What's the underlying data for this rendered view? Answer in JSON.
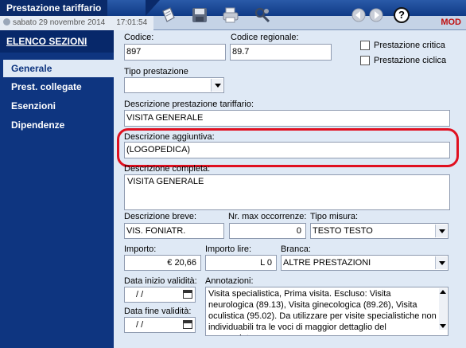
{
  "window": {
    "title": "Prestazione tariffario",
    "date": "sabato 29 novembre 2014",
    "time": "17:01:54",
    "mode_badge": "MOD"
  },
  "toolbar": {
    "icons": [
      "note-icon",
      "save-icon",
      "print-icon",
      "tools-icon",
      "back-arrow-icon",
      "forward-arrow-icon",
      "help-icon"
    ],
    "help_label": "?"
  },
  "sidebar": {
    "heading": "ELENCO SEZIONI",
    "items": [
      {
        "label": "Generale",
        "active": true
      },
      {
        "label": "Prest. collegate",
        "active": false
      },
      {
        "label": "Esenzioni",
        "active": false
      },
      {
        "label": "Dipendenze",
        "active": false
      }
    ]
  },
  "form": {
    "codice": {
      "label": "Codice:",
      "value": "897"
    },
    "codice_regionale": {
      "label": "Codice regionale:",
      "value": "89.7"
    },
    "prestazione_critica": {
      "label": "Prestazione critica",
      "checked": false
    },
    "prestazione_ciclica": {
      "label": "Prestazione ciclica",
      "checked": false
    },
    "tipo_prestazione": {
      "label": "Tipo prestazione",
      "value": ""
    },
    "descrizione_tariffario": {
      "label": "Descrizione prestazione tariffario:",
      "value": "VISITA GENERALE"
    },
    "descrizione_aggiuntiva": {
      "label": "Descrizione aggiuntiva:",
      "value": "(LOGOPEDICA)"
    },
    "descrizione_completa": {
      "label": "Descrizione completa:",
      "value": "VISITA GENERALE"
    },
    "descrizione_breve": {
      "label": "Descrizione breve:",
      "value": "VIS. FONIATR."
    },
    "nr_max_occorrenze": {
      "label": "Nr. max occorrenze:",
      "value": "0"
    },
    "tipo_misura": {
      "label": "Tipo misura:",
      "value": "TESTO TESTO"
    },
    "importo": {
      "label": "Importo:",
      "value": "€ 20,66"
    },
    "importo_lire": {
      "label": "Importo lire:",
      "value": "L 0"
    },
    "branca": {
      "label": "Branca:",
      "value": "ALTRE PRESTAZIONI"
    },
    "data_inizio": {
      "label": "Data inizio validità:",
      "value": "/ /"
    },
    "data_fine": {
      "label": "Data fine validità:",
      "value": "/ /"
    },
    "annotazioni": {
      "label": "Annotazioni:",
      "value": "Visita specialistica, Prima visita. Escluso: Visita neurologica (89.13), Visita ginecologica (89.26), Visita oculistica (95.02). Da utilizzare per visite specialistiche non individuabili tra le voci di maggior dettaglio del nomenclatore"
    }
  },
  "colors": {
    "accent": "#0e3580",
    "highlight": "#e01020",
    "mode_badge": "#c01010"
  }
}
